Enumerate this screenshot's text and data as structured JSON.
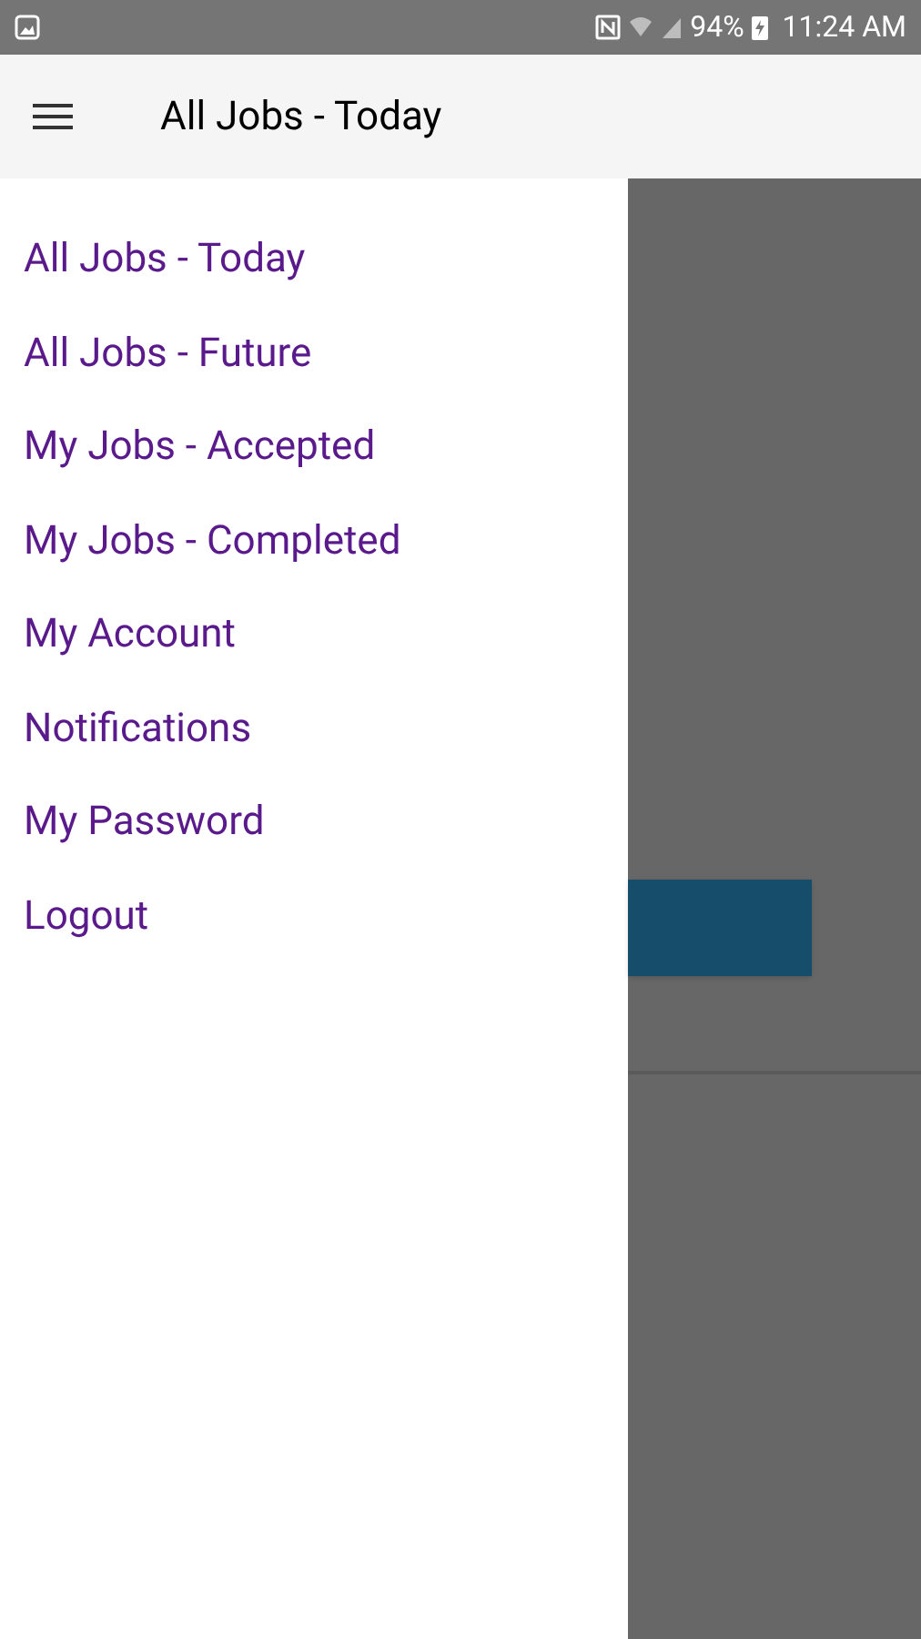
{
  "status_bar": {
    "battery": "94%",
    "time": "11:24 AM"
  },
  "app_bar": {
    "title": "All Jobs - Today"
  },
  "drawer": {
    "items": [
      {
        "label": "All Jobs - Today"
      },
      {
        "label": "All Jobs - Future"
      },
      {
        "label": "My Jobs - Accepted"
      },
      {
        "label": "My Jobs - Completed"
      },
      {
        "label": "My Account"
      },
      {
        "label": "Notifications"
      },
      {
        "label": "My Password"
      },
      {
        "label": "Logout"
      }
    ]
  }
}
